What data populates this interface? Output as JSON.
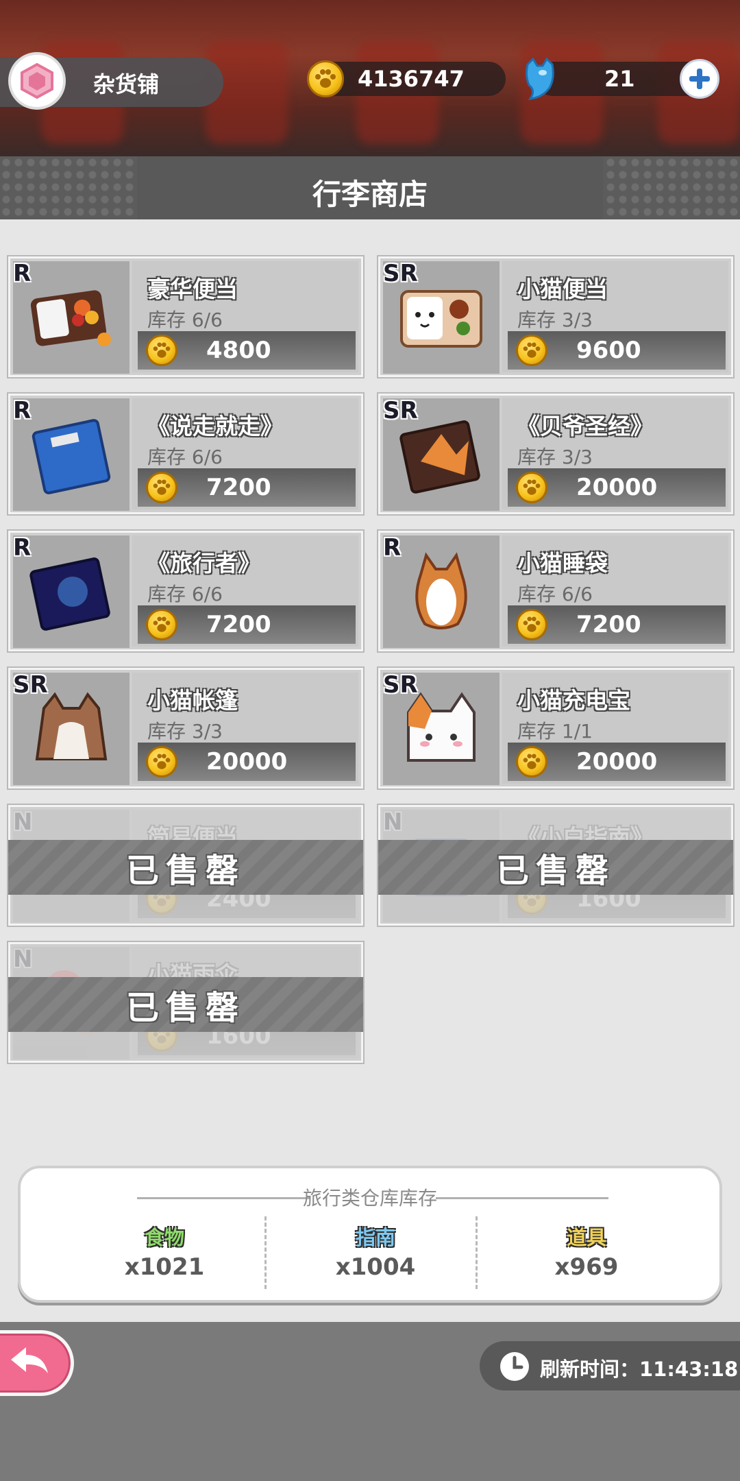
{
  "header": {
    "shop_name": "杂货铺",
    "coins": "4136747",
    "gems": "21",
    "icons": {
      "shop": "shop-hexagon-icon",
      "coin": "paw-coin-icon",
      "gem": "blue-cat-gem-icon",
      "add": "plus-icon"
    }
  },
  "title": "行李商店",
  "items": [
    {
      "rarity": "R",
      "name": "豪华便当",
      "stock": "库存 6/6",
      "price": "4800",
      "sold": false
    },
    {
      "rarity": "SR",
      "name": "小猫便当",
      "stock": "库存 3/3",
      "price": "9600",
      "sold": false
    },
    {
      "rarity": "R",
      "name": "《说走就走》",
      "stock": "库存 6/6",
      "price": "7200",
      "sold": false
    },
    {
      "rarity": "SR",
      "name": "《贝爷圣经》",
      "stock": "库存 3/3",
      "price": "20000",
      "sold": false
    },
    {
      "rarity": "R",
      "name": "《旅行者》",
      "stock": "库存 6/6",
      "price": "7200",
      "sold": false
    },
    {
      "rarity": "R",
      "name": "小猫睡袋",
      "stock": "库存 6/6",
      "price": "7200",
      "sold": false
    },
    {
      "rarity": "SR",
      "name": "小猫帐篷",
      "stock": "库存 3/3",
      "price": "20000",
      "sold": false
    },
    {
      "rarity": "SR",
      "name": "小猫充电宝",
      "stock": "库存 1/1",
      "price": "20000",
      "sold": false
    },
    {
      "rarity": "N",
      "name": "简易便当",
      "stock": "",
      "price": "2400",
      "sold": true
    },
    {
      "rarity": "N",
      "name": "《小白指南》",
      "stock": "",
      "price": "1600",
      "sold": true
    },
    {
      "rarity": "N",
      "name": "小猫雨伞",
      "stock": "",
      "price": "1600",
      "sold": true
    }
  ],
  "sold_out_label": "已售罄",
  "storage": {
    "title": "旅行类仓库库存",
    "columns": [
      {
        "label": "食物",
        "value": "x1021",
        "color": "#8fdc6a"
      },
      {
        "label": "指南",
        "value": "x1004",
        "color": "#7ec8f0"
      },
      {
        "label": "道具",
        "value": "x969",
        "color": "#f2d35a"
      }
    ]
  },
  "footer": {
    "refresh_label": "刷新时间：11:43:18",
    "icons": {
      "back": "back-arrow-icon",
      "clock": "clock-icon"
    }
  }
}
